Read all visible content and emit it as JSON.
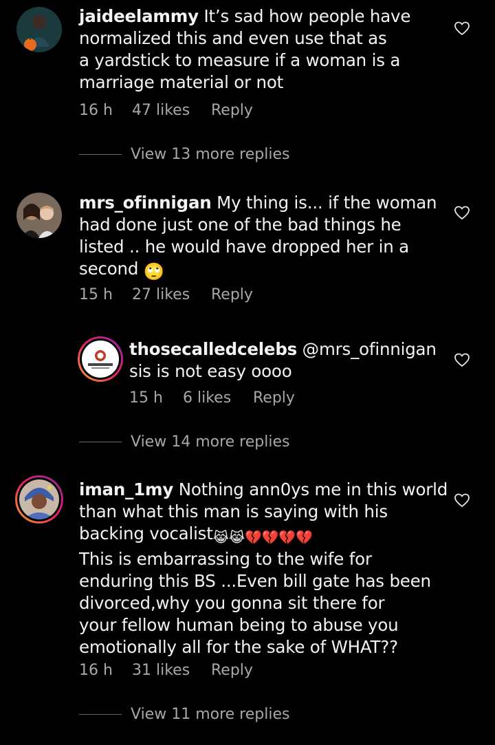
{
  "comments": [
    {
      "username": "jaideelammy",
      "text_lines": [
        "It’s sad how people have",
        "normalized this and even use that as",
        "a yardstick to measure if a woman is a",
        "marriage material or not"
      ],
      "time": "16 h",
      "likes": "47 likes",
      "reply": "Reply",
      "view_more": "View 13 more replies"
    },
    {
      "username": "mrs_ofinnigan",
      "text_lines": [
        "My thing is... if the woman",
        "had done just one of the bad things he",
        "listed .. he would have dropped her in a",
        "second"
      ],
      "emoji": "🙄",
      "time": "15 h",
      "likes": "27 likes",
      "reply": "Reply"
    },
    {
      "username": "thosecalledcelebs",
      "mention": "@mrs_ofinnigan",
      "text_lines": [
        "sis is not easy oooo"
      ],
      "time": "15 h",
      "likes": "6 likes",
      "reply": "Reply",
      "view_more": "View 14 more replies"
    },
    {
      "username": "iman_1my",
      "text_lines": [
        "Nothing ann0ys me in this world",
        "than  what this man is saying with his",
        "backing vocalist",
        "This is embarrassing to the wife for",
        "enduring this BS ...Even bill gate has been",
        "divorced,why you gonna sit there for",
        "your fellow human being to abuse you",
        "emotionally all for the sake of WHAT??"
      ],
      "emoji": "😹😹💔💔💔💔",
      "time": "16 h",
      "likes": "31 likes",
      "reply": "Reply",
      "view_more": "View 11 more replies"
    }
  ],
  "icons": {
    "like": "heart-outline-icon"
  },
  "colors": {
    "background": "#000000",
    "text": "#f3f3f3",
    "meta": "#a8a8a8"
  }
}
